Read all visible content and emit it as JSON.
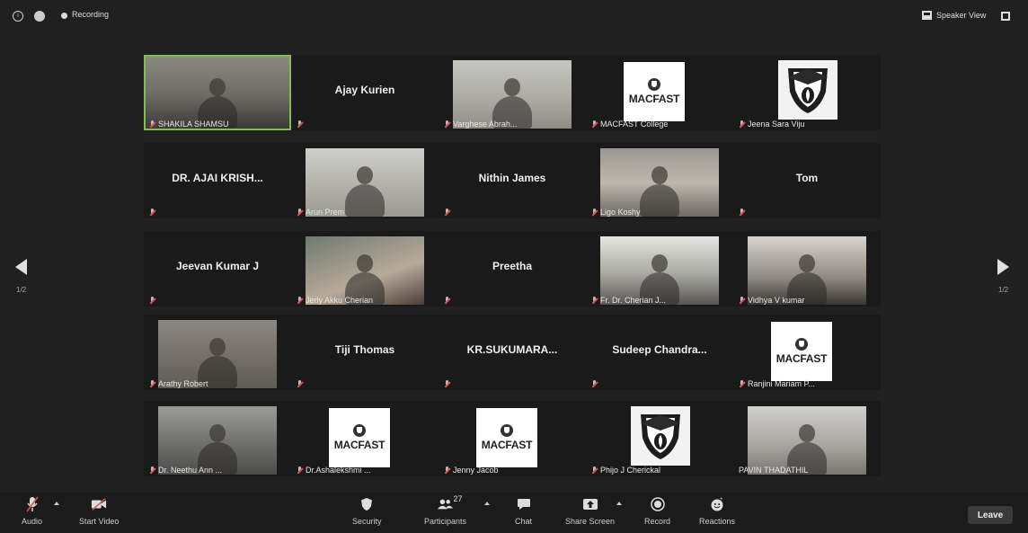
{
  "topbar": {
    "recording": "Recording",
    "speaker_view": "Speaker View"
  },
  "navigation": {
    "page_left": "1/2",
    "page_right": "1/2"
  },
  "participants": [
    {
      "name": "SHAKILA SHAMSU",
      "kind": "photo",
      "photo": "ph-1",
      "active": true
    },
    {
      "name": "Ajay Kurien",
      "kind": "name"
    },
    {
      "name": "Varghese Abrah...",
      "kind": "photo",
      "photo": "ph-2"
    },
    {
      "name": "MACFAST College",
      "kind": "macfast"
    },
    {
      "name": "Jeena Sara Viju",
      "kind": "shield"
    },
    {
      "name": "DR. AJAI KRISH...",
      "kind": "name"
    },
    {
      "name": "Arun Prem",
      "kind": "photo",
      "photo": "ph-3"
    },
    {
      "name": "Nithin James",
      "kind": "name"
    },
    {
      "name": "Ligo Koshy",
      "kind": "photo",
      "photo": "ph-4"
    },
    {
      "name": "Tom",
      "kind": "name"
    },
    {
      "name": "Jeevan Kumar J",
      "kind": "name"
    },
    {
      "name": "Jerly Akku Cherian",
      "kind": "photo",
      "photo": "ph-5"
    },
    {
      "name": "Preetha",
      "kind": "name"
    },
    {
      "name": "Fr. Dr. Cherian J...",
      "kind": "photo",
      "photo": "ph-6"
    },
    {
      "name": "Vidhya V kumar",
      "kind": "photo",
      "photo": "ph-7"
    },
    {
      "name": "Arathy Robert",
      "kind": "photo",
      "photo": "ph-8"
    },
    {
      "name": "Tiji Thomas",
      "kind": "name"
    },
    {
      "name": "KR.SUKUMARA...",
      "kind": "name"
    },
    {
      "name": "Sudeep  Chandra...",
      "kind": "name"
    },
    {
      "name": "Ranjini Mariam P...",
      "kind": "macfast"
    },
    {
      "name": "Dr. Neethu Ann ...",
      "kind": "photo",
      "photo": "ph-9"
    },
    {
      "name": "Dr.Ashalekshmi ...",
      "kind": "macfast"
    },
    {
      "name": "Jenny Jacob",
      "kind": "macfast"
    },
    {
      "name": "Phijo J Cherickal",
      "kind": "shield"
    },
    {
      "name": "PAVIN THADATHIL",
      "kind": "photo",
      "photo": "ph-10",
      "no_mute": true
    }
  ],
  "logo_text": "MACFAST",
  "toolbar": {
    "audio": "Audio",
    "start_video": "Start Video",
    "security": "Security",
    "participants": "Participants",
    "participants_count": "27",
    "chat": "Chat",
    "share_screen": "Share Screen",
    "record": "Record",
    "reactions": "Reactions",
    "leave": "Leave"
  }
}
